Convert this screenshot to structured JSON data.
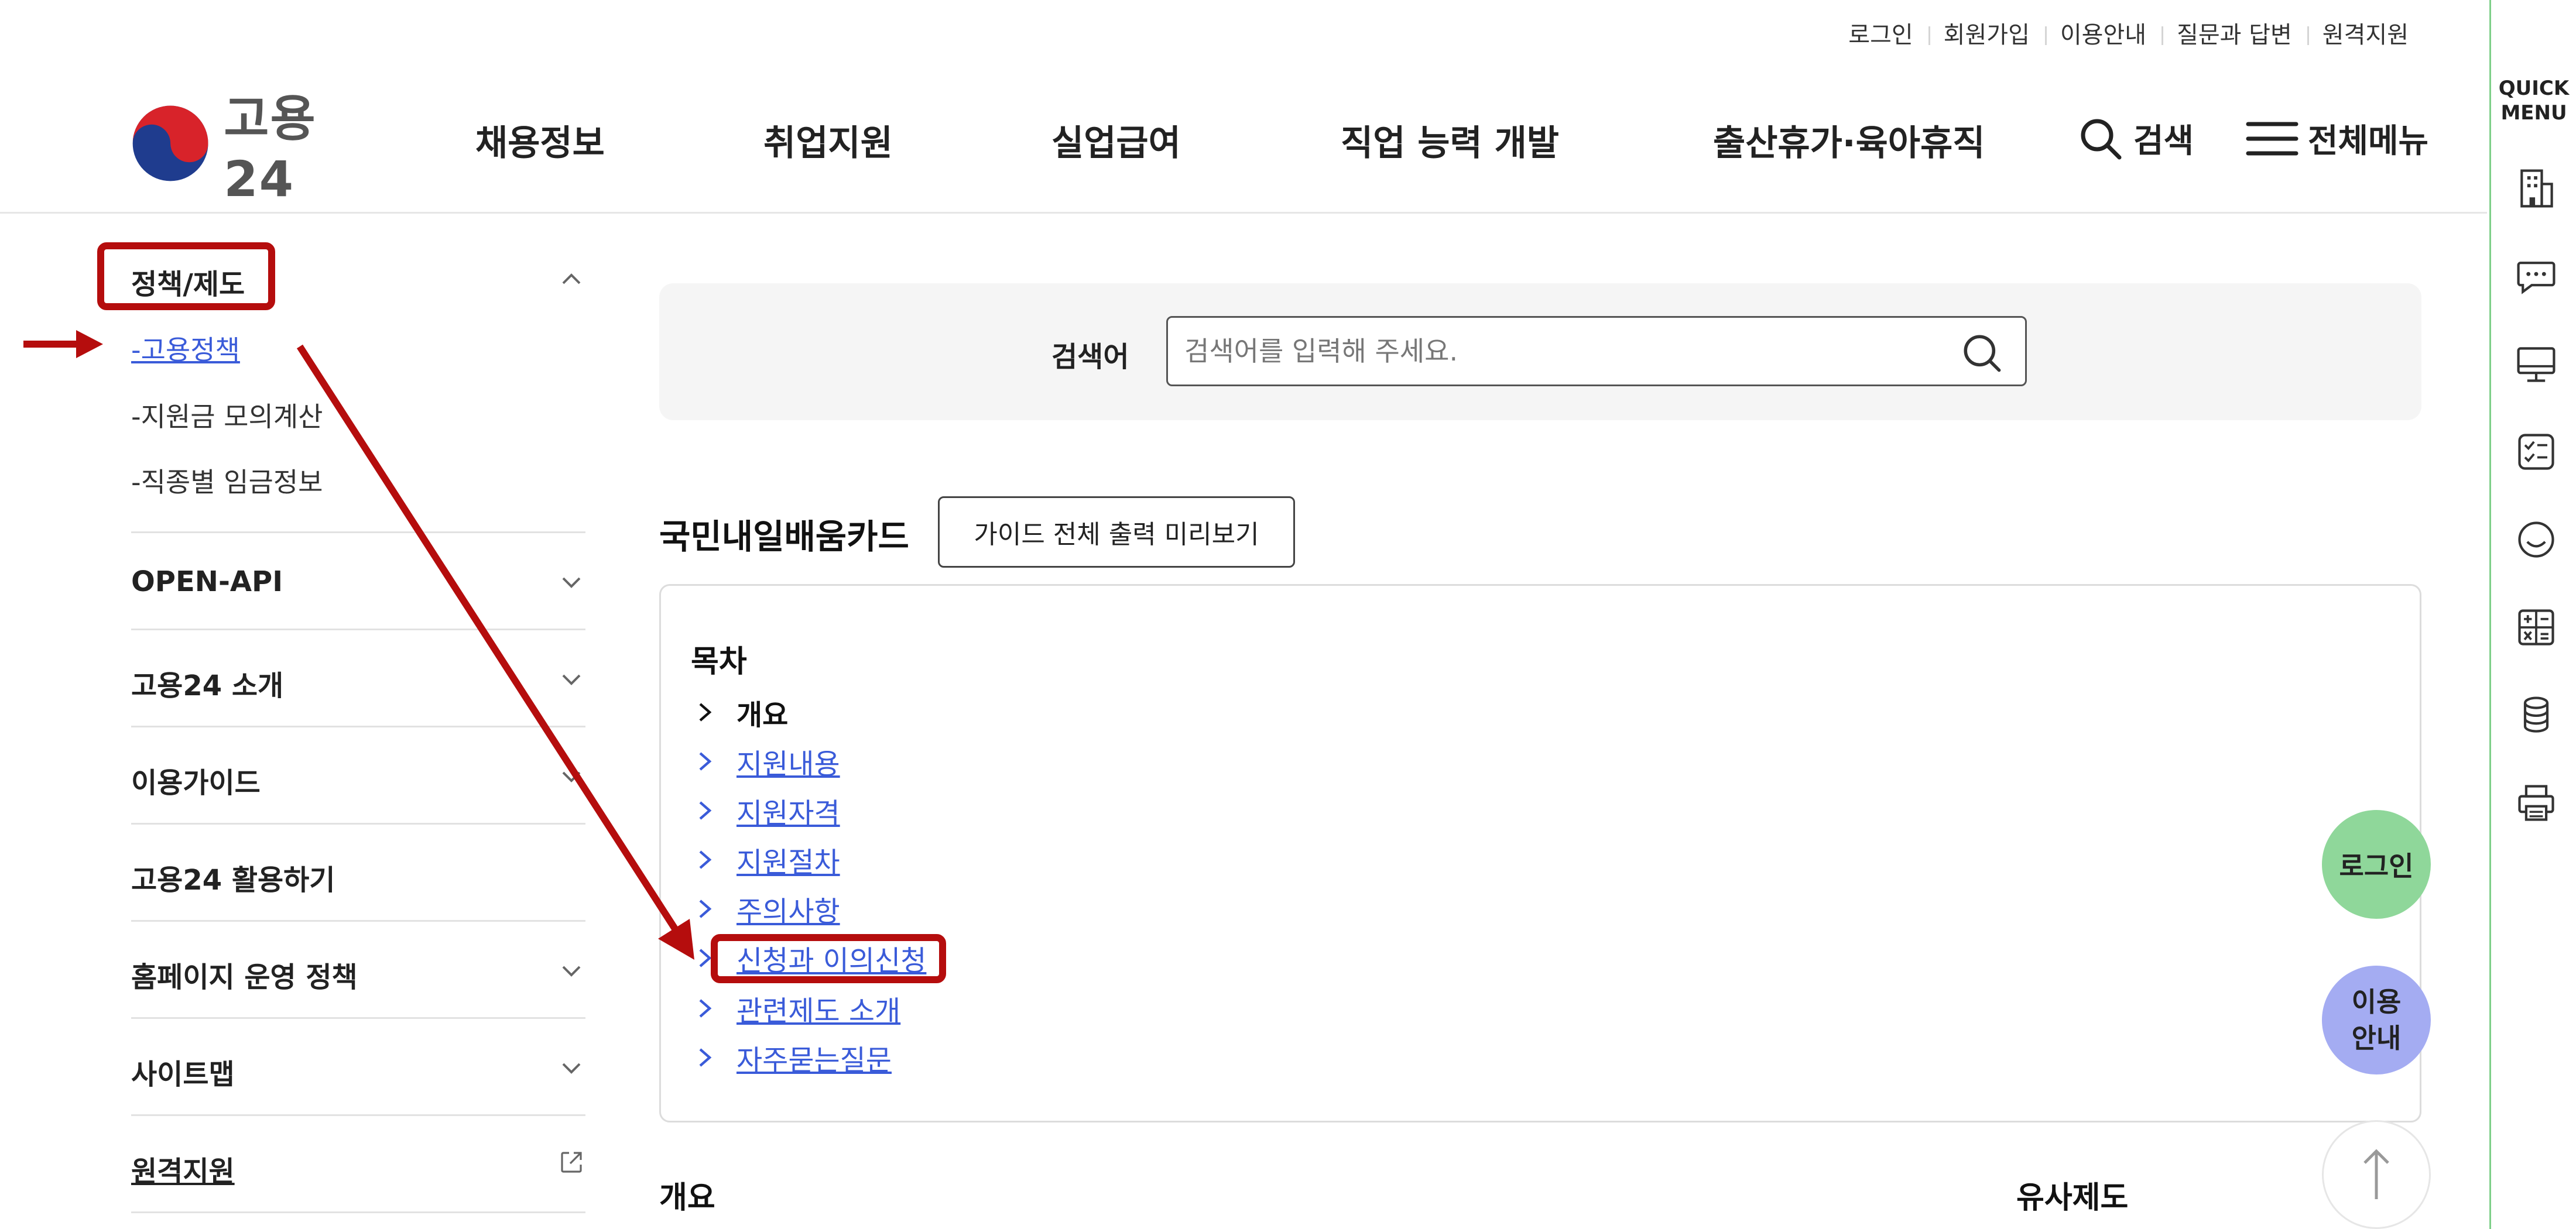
{
  "util_nav": [
    "로그인",
    "회원가입",
    "이용안내",
    "질문과 답변",
    "원격지원"
  ],
  "header": {
    "logo_text": "고용24",
    "gnb": [
      "채용정보",
      "취업지원",
      "실업급여",
      "직업 능력 개발",
      "출산휴가·육아휴직"
    ],
    "search_label": "검색",
    "menu_label": "전체메뉴"
  },
  "sidebar": {
    "sections": [
      {
        "title": "정책/제도",
        "expanded": true,
        "items": [
          "-고용정책",
          "-지원금 모의계산",
          "-직종별 임금정보"
        ]
      },
      {
        "title": "OPEN-API"
      },
      {
        "title": "고용24 소개"
      },
      {
        "title": "이용가이드"
      },
      {
        "title": "고용24 활용하기"
      },
      {
        "title": "홈페이지 운영 정책"
      },
      {
        "title": "사이트맵"
      },
      {
        "title": "원격지원"
      }
    ]
  },
  "search": {
    "label": "검색어",
    "placeholder": "검색어를 입력해 주세요."
  },
  "content": {
    "title": "국민내일배움카드",
    "guide_button": "가이드 전체 출력 미리보기",
    "toc_title": "목차",
    "toc_items": [
      "개요",
      "지원내용",
      "지원자격",
      "지원절차",
      "주의사항",
      "신청과 이의신청",
      "관련제도 소개",
      "자주묻는질문"
    ],
    "bottom_left": "개요",
    "bottom_right": "유사제도"
  },
  "floating": {
    "login": "로그인",
    "guide_line1": "이용",
    "guide_line2": "안내"
  },
  "quick_menu": {
    "title_line1": "QUICK",
    "title_line2": "MENU",
    "icons": [
      "building-icon",
      "chat-icon",
      "monitor-icon",
      "checklist-icon",
      "smile-icon",
      "calculator-icon",
      "coins-icon",
      "printer-icon"
    ]
  },
  "colors": {
    "link": "#3a5bd9",
    "annotation": "#b50d0d",
    "fab_login": "#8fd79a",
    "fab_guide": "#a4acf2",
    "quick_border": "#7fd08a"
  }
}
